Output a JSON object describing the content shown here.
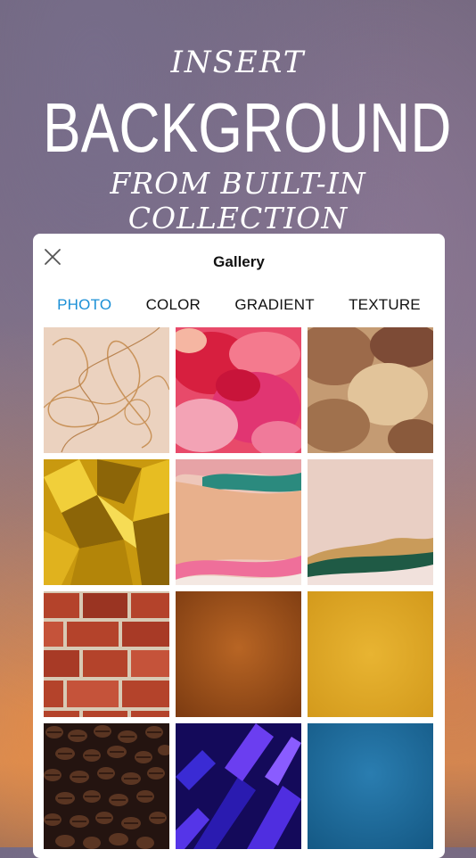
{
  "hero": {
    "line1": "INSERT",
    "line2": "BACKGROUND",
    "line3": "FROM BUILT-IN COLLECTION"
  },
  "dialog": {
    "title": "Gallery",
    "close_icon": "close-icon"
  },
  "tabs": [
    {
      "label": "PHOTO",
      "active": true
    },
    {
      "label": "COLOR",
      "active": false
    },
    {
      "label": "GRADIENT",
      "active": false
    },
    {
      "label": "TEXTURE",
      "active": false
    }
  ],
  "colors": {
    "accent": "#1a8fd6",
    "title_text": "#111111"
  },
  "gallery": [
    {
      "name": "gold-swirl-lines",
      "base": "#e9cdb8"
    },
    {
      "name": "pink-red-alcohol-ink",
      "base": "#e4305a"
    },
    {
      "name": "brown-watercolor-clouds",
      "base": "#b98557"
    },
    {
      "name": "gold-foil",
      "base": "#c99a12"
    },
    {
      "name": "peach-teal-torn-paper",
      "base": "#e9b08e"
    },
    {
      "name": "beige-green-torn-paper",
      "base": "#e7c9bd"
    },
    {
      "name": "red-brick-wall",
      "base": "#a8402a"
    },
    {
      "name": "brown-leather",
      "base": "#a2531b"
    },
    {
      "name": "mustard-yellow-felt",
      "base": "#e0a82a"
    },
    {
      "name": "coffee-beans",
      "base": "#3a2318"
    },
    {
      "name": "purple-geometric-neon",
      "base": "#2a1b8f"
    },
    {
      "name": "blue-fabric",
      "base": "#1c6b9a"
    }
  ]
}
